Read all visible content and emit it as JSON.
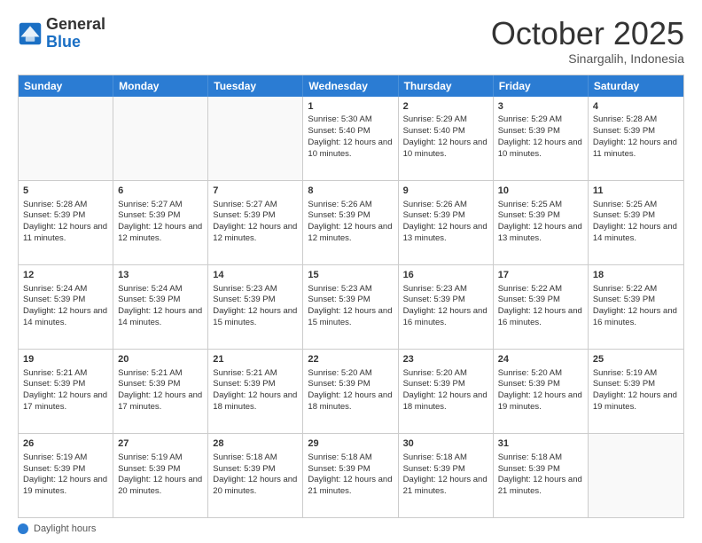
{
  "header": {
    "logo": {
      "text_general": "General",
      "text_blue": "Blue"
    },
    "title": "October 2025",
    "location": "Sinargalih, Indonesia"
  },
  "calendar": {
    "days_of_week": [
      "Sunday",
      "Monday",
      "Tuesday",
      "Wednesday",
      "Thursday",
      "Friday",
      "Saturday"
    ],
    "weeks": [
      [
        {
          "day": "",
          "empty": true
        },
        {
          "day": "",
          "empty": true
        },
        {
          "day": "",
          "empty": true
        },
        {
          "day": "1",
          "sunrise": "5:30 AM",
          "sunset": "5:40 PM",
          "daylight": "12 hours and 10 minutes."
        },
        {
          "day": "2",
          "sunrise": "5:29 AM",
          "sunset": "5:40 PM",
          "daylight": "12 hours and 10 minutes."
        },
        {
          "day": "3",
          "sunrise": "5:29 AM",
          "sunset": "5:39 PM",
          "daylight": "12 hours and 10 minutes."
        },
        {
          "day": "4",
          "sunrise": "5:28 AM",
          "sunset": "5:39 PM",
          "daylight": "12 hours and 11 minutes."
        }
      ],
      [
        {
          "day": "5",
          "sunrise": "5:28 AM",
          "sunset": "5:39 PM",
          "daylight": "12 hours and 11 minutes."
        },
        {
          "day": "6",
          "sunrise": "5:27 AM",
          "sunset": "5:39 PM",
          "daylight": "12 hours and 12 minutes."
        },
        {
          "day": "7",
          "sunrise": "5:27 AM",
          "sunset": "5:39 PM",
          "daylight": "12 hours and 12 minutes."
        },
        {
          "day": "8",
          "sunrise": "5:26 AM",
          "sunset": "5:39 PM",
          "daylight": "12 hours and 12 minutes."
        },
        {
          "day": "9",
          "sunrise": "5:26 AM",
          "sunset": "5:39 PM",
          "daylight": "12 hours and 13 minutes."
        },
        {
          "day": "10",
          "sunrise": "5:25 AM",
          "sunset": "5:39 PM",
          "daylight": "12 hours and 13 minutes."
        },
        {
          "day": "11",
          "sunrise": "5:25 AM",
          "sunset": "5:39 PM",
          "daylight": "12 hours and 14 minutes."
        }
      ],
      [
        {
          "day": "12",
          "sunrise": "5:24 AM",
          "sunset": "5:39 PM",
          "daylight": "12 hours and 14 minutes."
        },
        {
          "day": "13",
          "sunrise": "5:24 AM",
          "sunset": "5:39 PM",
          "daylight": "12 hours and 14 minutes."
        },
        {
          "day": "14",
          "sunrise": "5:23 AM",
          "sunset": "5:39 PM",
          "daylight": "12 hours and 15 minutes."
        },
        {
          "day": "15",
          "sunrise": "5:23 AM",
          "sunset": "5:39 PM",
          "daylight": "12 hours and 15 minutes."
        },
        {
          "day": "16",
          "sunrise": "5:23 AM",
          "sunset": "5:39 PM",
          "daylight": "12 hours and 16 minutes."
        },
        {
          "day": "17",
          "sunrise": "5:22 AM",
          "sunset": "5:39 PM",
          "daylight": "12 hours and 16 minutes."
        },
        {
          "day": "18",
          "sunrise": "5:22 AM",
          "sunset": "5:39 PM",
          "daylight": "12 hours and 16 minutes."
        }
      ],
      [
        {
          "day": "19",
          "sunrise": "5:21 AM",
          "sunset": "5:39 PM",
          "daylight": "12 hours and 17 minutes."
        },
        {
          "day": "20",
          "sunrise": "5:21 AM",
          "sunset": "5:39 PM",
          "daylight": "12 hours and 17 minutes."
        },
        {
          "day": "21",
          "sunrise": "5:21 AM",
          "sunset": "5:39 PM",
          "daylight": "12 hours and 18 minutes."
        },
        {
          "day": "22",
          "sunrise": "5:20 AM",
          "sunset": "5:39 PM",
          "daylight": "12 hours and 18 minutes."
        },
        {
          "day": "23",
          "sunrise": "5:20 AM",
          "sunset": "5:39 PM",
          "daylight": "12 hours and 18 minutes."
        },
        {
          "day": "24",
          "sunrise": "5:20 AM",
          "sunset": "5:39 PM",
          "daylight": "12 hours and 19 minutes."
        },
        {
          "day": "25",
          "sunrise": "5:19 AM",
          "sunset": "5:39 PM",
          "daylight": "12 hours and 19 minutes."
        }
      ],
      [
        {
          "day": "26",
          "sunrise": "5:19 AM",
          "sunset": "5:39 PM",
          "daylight": "12 hours and 19 minutes."
        },
        {
          "day": "27",
          "sunrise": "5:19 AM",
          "sunset": "5:39 PM",
          "daylight": "12 hours and 20 minutes."
        },
        {
          "day": "28",
          "sunrise": "5:18 AM",
          "sunset": "5:39 PM",
          "daylight": "12 hours and 20 minutes."
        },
        {
          "day": "29",
          "sunrise": "5:18 AM",
          "sunset": "5:39 PM",
          "daylight": "12 hours and 21 minutes."
        },
        {
          "day": "30",
          "sunrise": "5:18 AM",
          "sunset": "5:39 PM",
          "daylight": "12 hours and 21 minutes."
        },
        {
          "day": "31",
          "sunrise": "5:18 AM",
          "sunset": "5:39 PM",
          "daylight": "12 hours and 21 minutes."
        },
        {
          "day": "",
          "empty": true
        }
      ]
    ]
  },
  "footer": {
    "label": "Daylight hours"
  }
}
